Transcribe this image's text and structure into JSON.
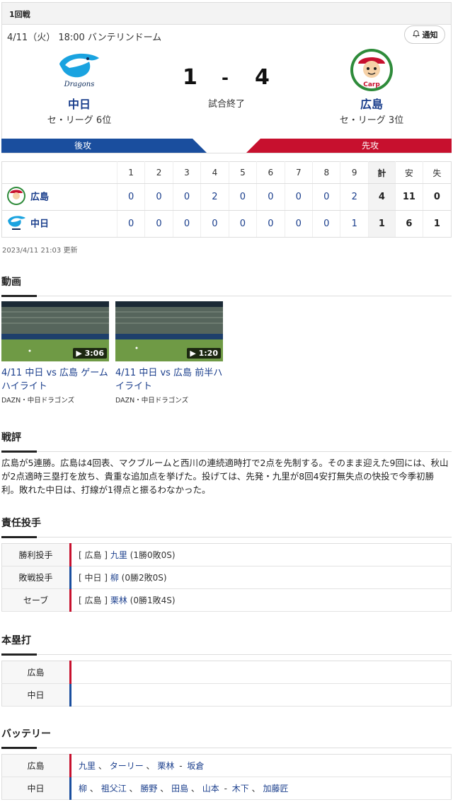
{
  "game": {
    "round": "1回戦",
    "date_venue": "4/11（火） 18:00 バンテリンドーム",
    "notify_label": "通知",
    "home": {
      "name": "中日",
      "rank": "セ・リーグ 6位",
      "score": "1",
      "side": "後攻",
      "color": "#1a4e9e"
    },
    "away": {
      "name": "広島",
      "rank": "セ・リーグ 3位",
      "score": "4",
      "side": "先攻",
      "color": "#c7102e"
    },
    "dash": "-",
    "status": "試合終了"
  },
  "scoreboard": {
    "headers": [
      "1",
      "2",
      "3",
      "4",
      "5",
      "6",
      "7",
      "8",
      "9",
      "計",
      "安",
      "失"
    ],
    "rows": [
      {
        "team": "広島",
        "cells": [
          "0",
          "0",
          "0",
          "2",
          "0",
          "0",
          "0",
          "0",
          "2",
          "4",
          "11",
          "0"
        ]
      },
      {
        "team": "中日",
        "cells": [
          "0",
          "0",
          "0",
          "0",
          "0",
          "0",
          "0",
          "0",
          "1",
          "1",
          "6",
          "1"
        ]
      }
    ],
    "updated": "2023/4/11 21:03 更新"
  },
  "videos": {
    "heading": "動画",
    "items": [
      {
        "title": "4/11 中日 vs 広島 ゲームハイライト",
        "source": "DAZN・中日ドラゴンズ",
        "duration": "3:06"
      },
      {
        "title": "4/11 中日 vs 広島 前半ハイライト",
        "source": "DAZN・中日ドラゴンズ",
        "duration": "1:20"
      }
    ]
  },
  "review": {
    "heading": "戦評",
    "text": "広島が5連勝。広島は4回表、マクブルームと西川の連続適時打で2点を先制する。そのまま迎えた9回には、秋山が2点適時三塁打を放ち、貴重な追加点を挙げた。投げては、先発・九里が8回4安打無失点の快投で今季初勝利。敗れた中日は、打線が1得点と振るわなかった。"
  },
  "pitchers": {
    "heading": "責任投手",
    "rows": [
      {
        "label": "勝利投手",
        "team": "[ 広島 ]",
        "name": "九里",
        "record": "(1勝0敗0S)"
      },
      {
        "label": "敗戦投手",
        "team": "[ 中日 ]",
        "name": "柳",
        "record": "(0勝2敗0S)"
      },
      {
        "label": "セーブ",
        "team": "[ 広島 ]",
        "name": "栗林",
        "record": "(0勝1敗4S)"
      }
    ]
  },
  "homeruns": {
    "heading": "本塁打",
    "rows": [
      {
        "label": "広島"
      },
      {
        "label": "中日"
      }
    ]
  },
  "battery": {
    "heading": "バッテリー",
    "rows": [
      {
        "label": "広島",
        "pitchers": [
          "九里",
          "ターリー",
          "栗林"
        ],
        "catchers": [
          "坂倉"
        ]
      },
      {
        "label": "中日",
        "pitchers": [
          "柳",
          "祖父江",
          "勝野",
          "田島",
          "山本"
        ],
        "catchers": [
          "木下",
          "加藤匠"
        ]
      }
    ],
    "sep": "、",
    "dash": "-"
  }
}
